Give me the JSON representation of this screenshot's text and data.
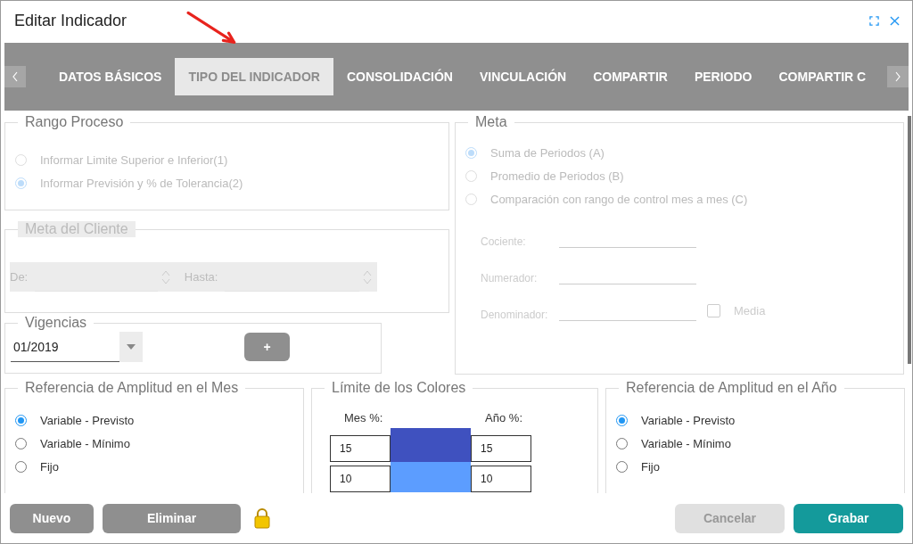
{
  "window": {
    "title": "Editar Indicador"
  },
  "tabs": [
    {
      "label": "DATOS BÁSICOS",
      "selected": false
    },
    {
      "label": "TIPO DEL INDICADOR",
      "selected": true
    },
    {
      "label": "CONSOLIDACIÓN",
      "selected": false
    },
    {
      "label": "VINCULACIÓN",
      "selected": false
    },
    {
      "label": "COMPARTIR",
      "selected": false
    },
    {
      "label": "PERIODO",
      "selected": false
    },
    {
      "label": "COMPARTIR C",
      "selected": false
    }
  ],
  "rango_proceso": {
    "title": "Rango Proceso",
    "disabled": true,
    "options": [
      {
        "label": "Informar Limite Superior e Inferior(1)",
        "selected": false
      },
      {
        "label": "Informar Previsión y % de Tolerancia(2)",
        "selected": true
      }
    ]
  },
  "meta_cliente": {
    "title": "Meta del Cliente",
    "disabled": true,
    "fields": [
      {
        "label": "De:"
      },
      {
        "label": "Hasta:"
      }
    ]
  },
  "vigencias": {
    "title": "Vigencias",
    "value": "01/2019",
    "add_button": "+"
  },
  "meta": {
    "title": "Meta",
    "disabled": true,
    "options": [
      {
        "label": "Suma de Periodos (A)",
        "selected": true
      },
      {
        "label": "Promedio de Periodos (B)",
        "selected": false
      },
      {
        "label": "Comparación con rango de control mes a mes (C)",
        "selected": false
      }
    ],
    "fields": [
      {
        "label": "Cociente:"
      },
      {
        "label": "Numerador:"
      },
      {
        "label": "Denominador:"
      }
    ],
    "media": {
      "label": "Media",
      "checked": false
    }
  },
  "amplitud_mes": {
    "title": "Referencia de Amplitud en el Mes",
    "options": [
      {
        "label": "Variable - Previsto",
        "selected": true
      },
      {
        "label": "Variable - Mínimo",
        "selected": false
      },
      {
        "label": "Fijo",
        "selected": false
      }
    ]
  },
  "limite_colores": {
    "title": "Límite de los Colores",
    "mes_label": "Mes %:",
    "ano_label": "Año %:",
    "rows": [
      {
        "mes": "15",
        "ano": "15",
        "color": "#3f51bf"
      },
      {
        "mes": "10",
        "ano": "10",
        "color": "#5c9dff"
      }
    ]
  },
  "amplitud_ano": {
    "title": "Referencia de Amplitud en el Año",
    "options": [
      {
        "label": "Variable - Previsto",
        "selected": true
      },
      {
        "label": "Variable - Mínimo",
        "selected": false
      },
      {
        "label": "Fijo",
        "selected": false
      }
    ]
  },
  "footer": {
    "left_buttons": [
      {
        "label": "Nuevo",
        "kind": "secondary"
      },
      {
        "label": "Eliminar",
        "kind": "secondary"
      }
    ],
    "right_buttons": [
      {
        "label": "Cancelar",
        "kind": "disabled"
      },
      {
        "label": "Grabar",
        "kind": "primary"
      }
    ]
  }
}
